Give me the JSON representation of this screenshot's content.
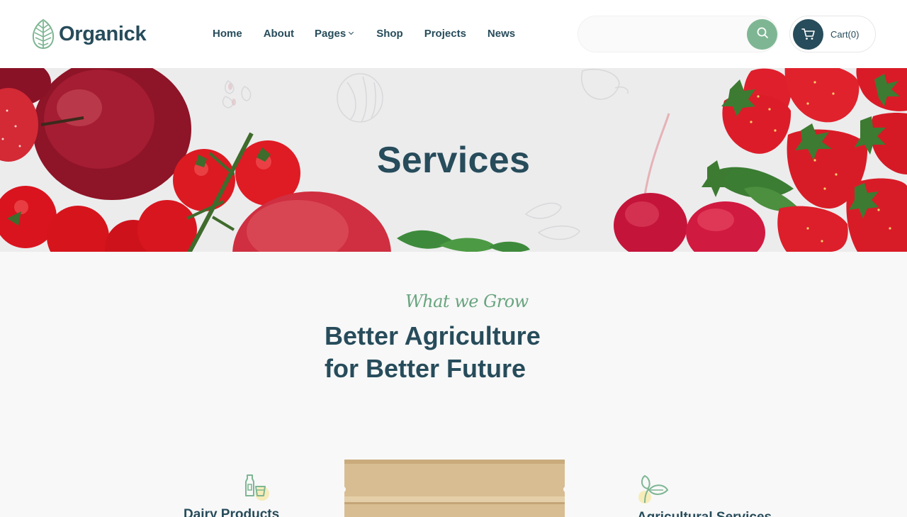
{
  "brand": {
    "name": "Organick",
    "logo_icon": "leaf-logo-icon"
  },
  "nav": {
    "items": [
      {
        "label": "Home"
      },
      {
        "label": "About"
      },
      {
        "label": "Pages",
        "has_dropdown": true
      },
      {
        "label": "Shop"
      },
      {
        "label": "Projects"
      },
      {
        "label": "News"
      }
    ]
  },
  "search": {
    "placeholder": "",
    "value": "",
    "button_icon": "search-icon"
  },
  "cart": {
    "label": "Cart(0)",
    "icon": "cart-icon"
  },
  "hero": {
    "title": "Services"
  },
  "section": {
    "subtitle": "What we Grow",
    "heading_line1": "Better Agriculture",
    "heading_line2": "for Better Future"
  },
  "services": [
    {
      "title": "Dairy Products",
      "icon": "dairy-bottle-icon"
    },
    {
      "title": "Agricultural Services",
      "icon": "sprout-leaf-icon"
    }
  ],
  "colors": {
    "primary": "#274c5b",
    "accent": "#7eb693",
    "script": "#68a47f",
    "highlight": "#efd372"
  }
}
